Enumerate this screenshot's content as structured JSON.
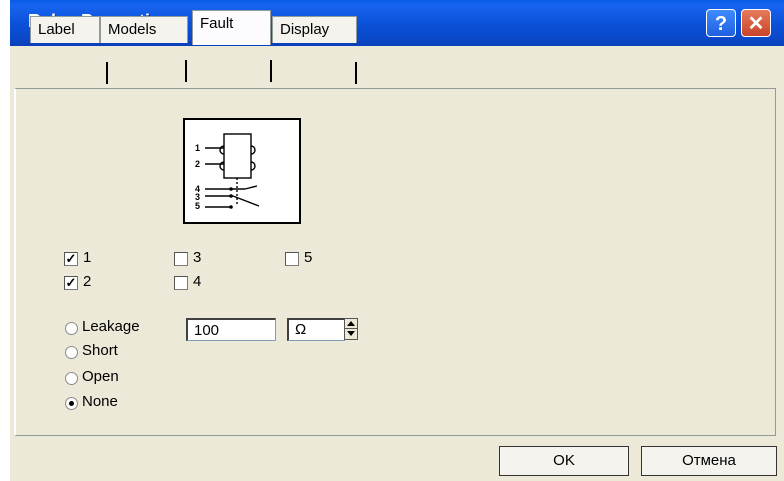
{
  "window": {
    "title": "Relay Properties",
    "help_glyph": "?",
    "close_glyph": "✕"
  },
  "tabs": [
    {
      "label": "Label"
    },
    {
      "label": "Models"
    },
    {
      "label": "Fault",
      "active": true
    },
    {
      "label": "Display"
    }
  ],
  "diagram": {
    "pins": [
      "1",
      "2",
      "4",
      "3",
      "5"
    ]
  },
  "pins": [
    {
      "label": "1",
      "checked": true
    },
    {
      "label": "2",
      "checked": true
    },
    {
      "label": "3",
      "checked": false
    },
    {
      "label": "4",
      "checked": false
    },
    {
      "label": "5",
      "checked": false
    }
  ],
  "fault_modes": [
    {
      "label": "Leakage",
      "selected": false
    },
    {
      "label": "Short",
      "selected": false
    },
    {
      "label": "Open",
      "selected": false
    },
    {
      "label": "None",
      "selected": true
    }
  ],
  "leakage": {
    "value": "100",
    "unit": "Ω"
  },
  "buttons": {
    "ok": "OK",
    "cancel": "Отмена"
  },
  "colors": {
    "titlebar": "#0a50d6",
    "face": "#ece9d8",
    "close": "#c8442a"
  }
}
